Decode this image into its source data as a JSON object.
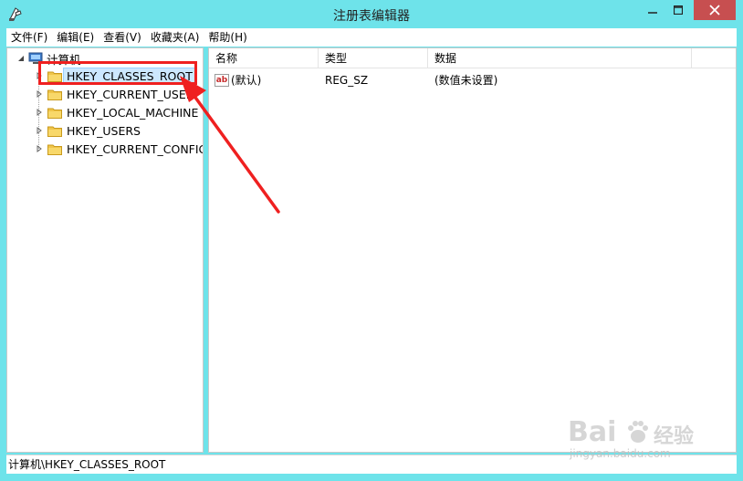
{
  "window": {
    "title": "注册表编辑器",
    "app_icon": "registry-editor-icon"
  },
  "menu": [
    "文件(F)",
    "编辑(E)",
    "查看(V)",
    "收藏夹(A)",
    "帮助(H)"
  ],
  "tree": {
    "root_label": "计算机",
    "root_icon": "computer-icon",
    "items": [
      {
        "label": "HKEY_CLASSES_ROOT",
        "selected": true
      },
      {
        "label": "HKEY_CURRENT_USER",
        "selected": false
      },
      {
        "label": "HKEY_LOCAL_MACHINE",
        "selected": false
      },
      {
        "label": "HKEY_USERS",
        "selected": false
      },
      {
        "label": "HKEY_CURRENT_CONFIG",
        "selected": false
      }
    ]
  },
  "list": {
    "columns": [
      "名称",
      "类型",
      "数据"
    ],
    "rows": [
      {
        "name": "(默认)",
        "type": "REG_SZ",
        "data": "(数值未设置)",
        "icon": "string-value-icon"
      }
    ]
  },
  "status": "计算机\\HKEY_CLASSES_ROOT",
  "watermark": {
    "brand": "Bai",
    "brand2": "经验",
    "url": "jingyan.baidu.com"
  },
  "colors": {
    "titlebar": "#6ee3ea",
    "close_button": "#c74f50",
    "annotation": "#ef2020",
    "selection": "#cce8ff"
  }
}
